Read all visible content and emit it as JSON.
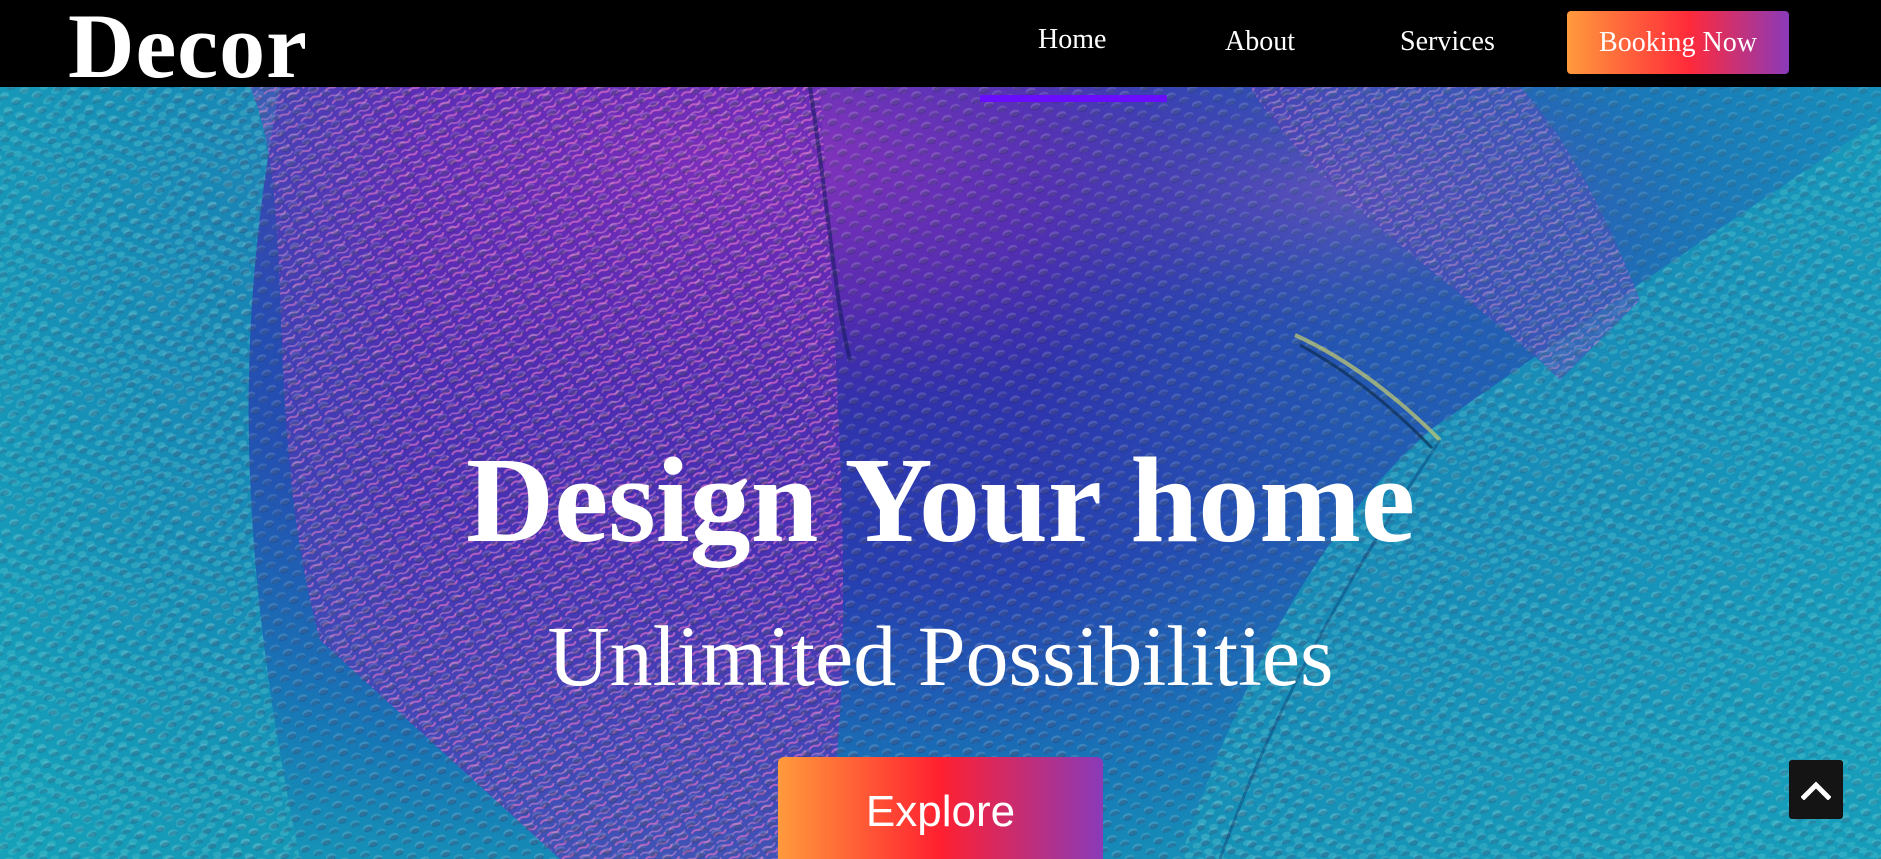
{
  "brand": {
    "logo_text": "Decor"
  },
  "nav": {
    "items": [
      {
        "label": "Home",
        "active": true
      },
      {
        "label": "About",
        "active": false
      },
      {
        "label": "Services",
        "active": false
      }
    ],
    "cta_label": "Booking Now"
  },
  "hero": {
    "title": "Design Your home",
    "subtitle": "Unlimited Possibilities",
    "cta_label": "Explore"
  },
  "icons": {
    "scroll_top": "chevron-up-icon"
  },
  "colors": {
    "nav_bg": "#000000",
    "active_underline": "#6a0dff",
    "gradient_start": "#ff9a3c",
    "gradient_mid": "#ff2a3a",
    "gradient_end": "#8a3ab9",
    "fabric_teal": "#1ea6c4",
    "fabric_blue": "#2a3fb0",
    "fabric_magenta": "#c24ad6"
  }
}
